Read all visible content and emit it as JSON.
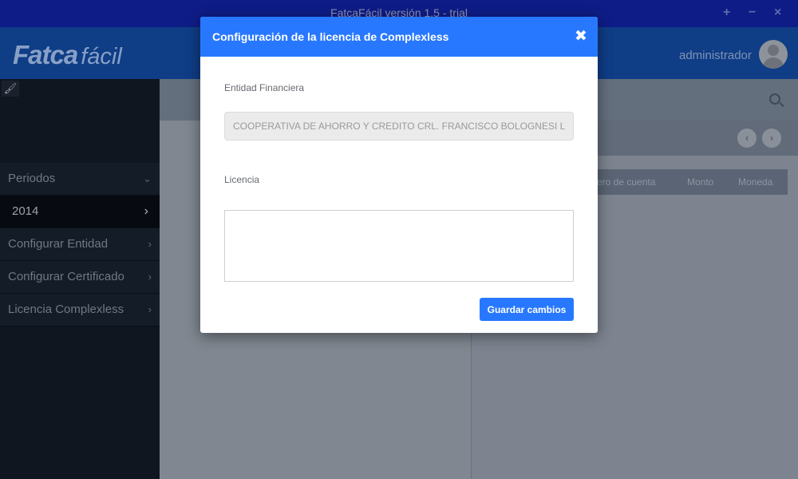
{
  "window": {
    "title": "FatcaFácil versión 1.5 - trial",
    "controls": {
      "minimize_glyph": "−",
      "maximize_glyph": "+",
      "close_glyph": "×"
    }
  },
  "header": {
    "logo_primary": "Fatca",
    "logo_secondary": "fácil",
    "user_name": "administrador",
    "avatar_icon": "user-avatar-icon"
  },
  "sidebar": {
    "tool_icon": "brush-icon",
    "items": [
      {
        "label": "Periodos",
        "chevron": "⌄"
      },
      {
        "label": "2014",
        "chevron": "›"
      },
      {
        "label": "Configurar Entidad",
        "chevron": "›"
      },
      {
        "label": "Configurar Certificado",
        "chevron": "›"
      },
      {
        "label": "Licencia Complexless",
        "chevron": "›"
      }
    ]
  },
  "main": {
    "search_icon": "search-icon",
    "nav_prev": "‹",
    "nav_next": "›",
    "table_columns": [
      "ero de cuenta",
      "Monto",
      "Moneda"
    ]
  },
  "modal": {
    "title": "Configuración de la licencia de Complexless",
    "close_glyph": "✖",
    "entity_label": "Entidad Financiera",
    "entity_value": "COOPERATIVA DE AHORRO Y CREDITO CRL. FRANCISCO BOLOGNESI LTDA",
    "license_label": "Licencia",
    "license_value": "",
    "save_label": "Guardar cambios"
  },
  "colors": {
    "accent": "#2878ff",
    "titlebar_bg": "#0e1c87",
    "sidebar_bg": "#0f1620"
  }
}
